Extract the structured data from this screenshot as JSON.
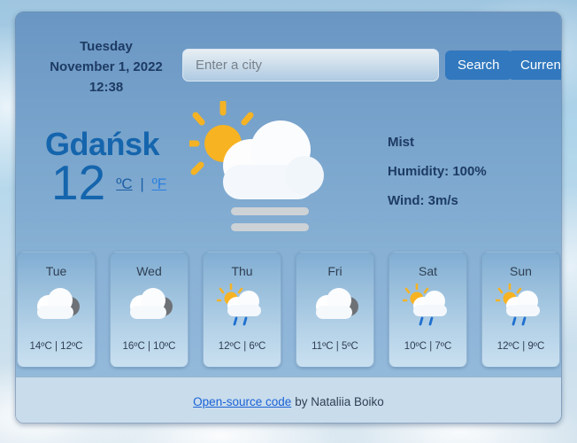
{
  "header": {
    "weekday": "Tuesday",
    "date": "November 1, 2022",
    "time": "12:38"
  },
  "search": {
    "placeholder": "Enter a city",
    "value": "",
    "search_label": "Search",
    "current_label": "Current"
  },
  "current": {
    "city": "Gdańsk",
    "temperature": "12",
    "unit_celsius": "ºC",
    "unit_separator": "|",
    "unit_fahrenheit": "ºF",
    "icon": "sun-behind-cloud-with-mist-icon",
    "description": "Mist",
    "humidity": "Humidity: 100%",
    "wind": "Wind: 3m/s"
  },
  "forecast": [
    {
      "day": "Tue",
      "icon": "cloud-icon",
      "temps": "14ºC | 12ºC"
    },
    {
      "day": "Wed",
      "icon": "cloud-icon",
      "temps": "16ºC | 10ºC"
    },
    {
      "day": "Thu",
      "icon": "sun-rain-cloud-icon",
      "temps": "12ºC | 6ºC"
    },
    {
      "day": "Fri",
      "icon": "cloud-icon",
      "temps": "11ºC | 5ºC"
    },
    {
      "day": "Sat",
      "icon": "sun-rain-cloud-icon",
      "temps": "10ºC | 7ºC"
    },
    {
      "day": "Sun",
      "icon": "sun-rain-cloud-icon",
      "temps": "12ºC | 9ºC"
    }
  ],
  "footer": {
    "link_text": "Open-source code",
    "credit": "by Nataliia Boiko"
  },
  "colors": {
    "accent_blue": "#3178be",
    "city_blue": "#1565ad",
    "link_blue": "#1a62d6",
    "text_navy": "#1d3b63",
    "sun_yellow": "#f5b324",
    "rain_blue": "#1f6fd0"
  }
}
